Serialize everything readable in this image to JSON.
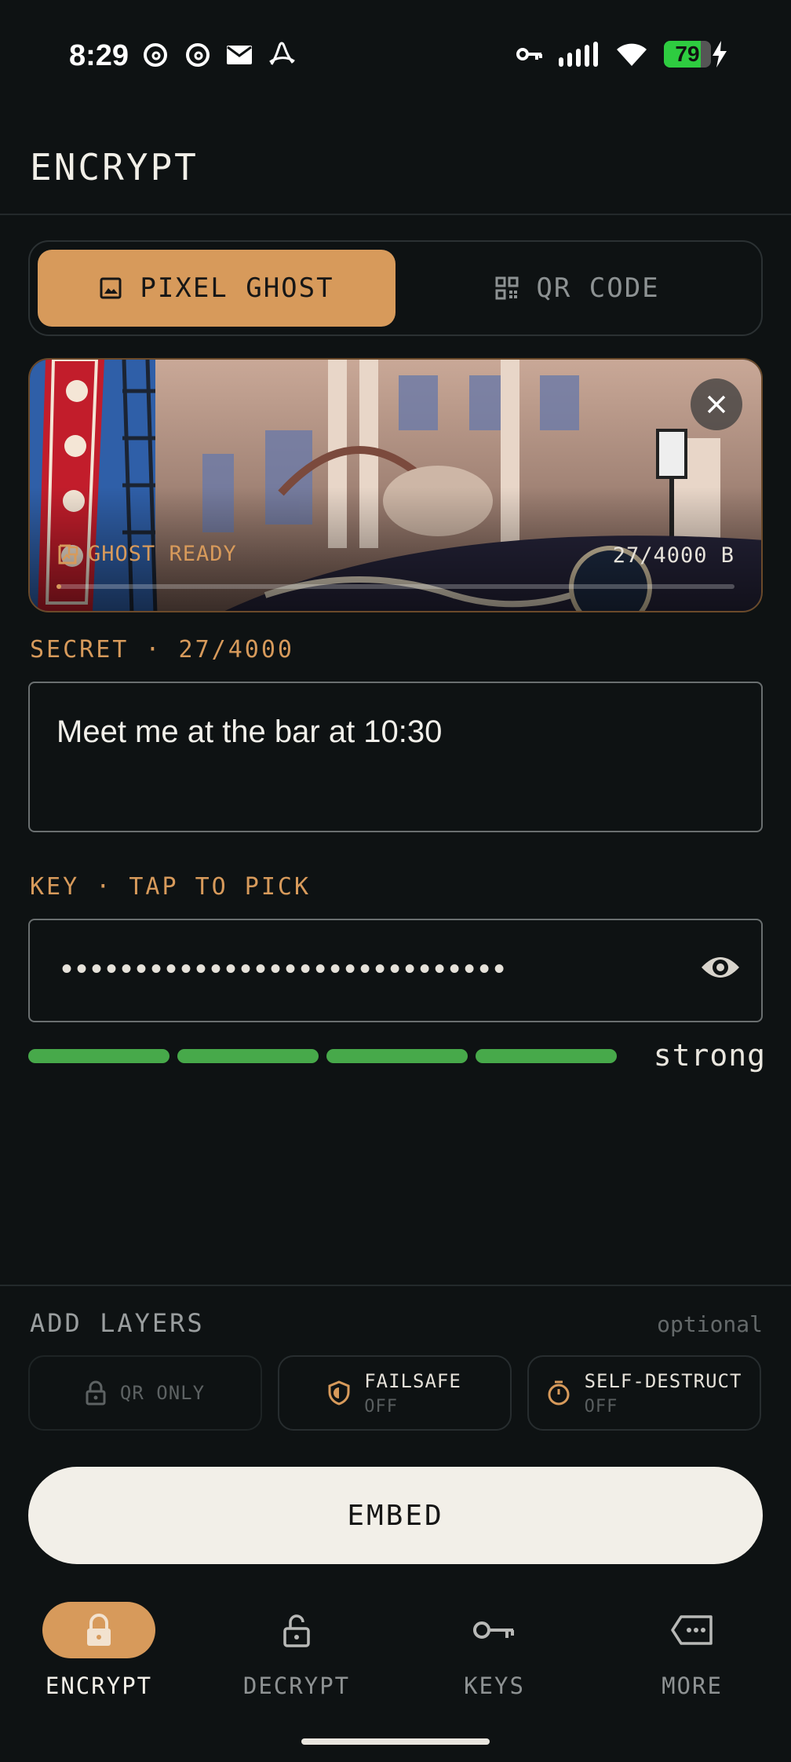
{
  "status_bar": {
    "time": "8:29",
    "battery": "79",
    "battery_level": 0.79,
    "left_icons": [
      "threads-icon",
      "threads-icon",
      "mail-icon",
      "acrobat-icon"
    ],
    "right_icons": [
      "vpn-key-icon",
      "signal-icon",
      "wifi-icon",
      "battery-icon",
      "charging-icon"
    ]
  },
  "header": {
    "title": "ENCRYPT"
  },
  "mode_tabs": [
    {
      "label": "PIXEL GHOST",
      "icon": "image-icon",
      "active": true
    },
    {
      "label": "QR CODE",
      "icon": "qr-icon",
      "active": false
    }
  ],
  "image_card": {
    "status": "GHOST READY",
    "bytes": "27/4000 B",
    "capacity_used": 0.00675
  },
  "secret": {
    "label": "SECRET · 27/4000",
    "value": "Meet me at the bar at 10:30"
  },
  "key": {
    "label": "KEY · TAP TO PICK",
    "masked_value": "••••••••••••••••••••••••••••••",
    "strength_label": "strong",
    "strength_level": 4,
    "strength_max": 4
  },
  "layers": {
    "title": "ADD LAYERS",
    "optional": "optional",
    "items": [
      {
        "name": "QR ONLY",
        "sub": "",
        "icon": "lock-icon",
        "enabled": false
      },
      {
        "name": "FAILSAFE",
        "sub": "OFF",
        "icon": "shield-icon",
        "enabled": true
      },
      {
        "name": "SELF-DESTRUCT",
        "sub": "OFF",
        "icon": "timer-icon",
        "enabled": true
      }
    ]
  },
  "embed_button": "EMBED",
  "nav": [
    {
      "label": "ENCRYPT",
      "icon": "lock-icon",
      "active": true
    },
    {
      "label": "DECRYPT",
      "icon": "unlock-icon",
      "active": false
    },
    {
      "label": "KEYS",
      "icon": "key-icon",
      "active": false
    },
    {
      "label": "MORE",
      "icon": "more-icon",
      "active": false
    }
  ],
  "colors": {
    "background": "#0e1213",
    "accent": "#d79a5b",
    "strength": "#47a94a",
    "button": "#f2efe8"
  }
}
